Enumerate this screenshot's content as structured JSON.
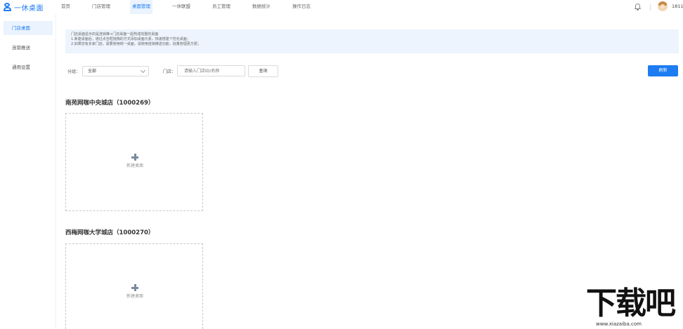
{
  "app": {
    "logo_text": "一休桌面"
  },
  "nav": {
    "items": [
      {
        "label": "首页",
        "active": false
      },
      {
        "label": "门店管理",
        "active": false
      },
      {
        "label": "桌面管理",
        "active": true
      },
      {
        "label": "一休联盟",
        "active": false
      },
      {
        "label": "员工管理",
        "active": false
      },
      {
        "label": "数据统计",
        "active": false
      },
      {
        "label": "操作日志",
        "active": false
      }
    ]
  },
  "user": {
    "name": "18110"
  },
  "sidebar": {
    "items": [
      {
        "label": "门店桌面",
        "active": true
      },
      {
        "label": "连锁推送",
        "active": false
      },
      {
        "label": "通用设置",
        "active": false
      }
    ]
  },
  "notice": {
    "lines": [
      "门店桌面显示的是连锁推+门店桌面一起构成完整的桌面",
      "1.新建桌面后，通过点击框拖拽的方式添加桌面元素，快速搭建个性化桌面；",
      "2.如果您有多家门店，需要使用统一桌面，请使用连锁推送功能，批量管理更方便；"
    ]
  },
  "filters": {
    "group_label": "分组：",
    "group_value": "全部",
    "store_label": "门店：",
    "store_placeholder": "请输入门店ID/名称",
    "query_label": "查询",
    "refresh_label": "刷新"
  },
  "stores": [
    {
      "title": "南苑网咖中央城店（1000269）",
      "new_label": "新建桌面"
    },
    {
      "title": "西梅网咖大学城店（1000270）",
      "new_label": "新建桌面"
    }
  ],
  "watermark": {
    "main": "下载吧",
    "url": "www.xiazaiba.com"
  },
  "colors": {
    "accent": "#1d7cf2",
    "notice_bg": "#edf4fd"
  }
}
